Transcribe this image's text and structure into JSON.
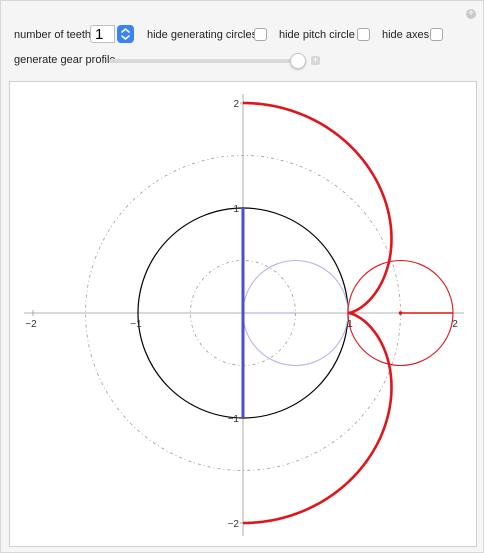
{
  "controls": {
    "num_teeth_label": "number of teeth",
    "num_teeth_value": "1",
    "hide_generating_label": "hide generating circles",
    "hide_pitch_label": "hide pitch circle",
    "hide_axes_label": "hide axes",
    "generate_profile_label": "generate gear profile",
    "generate_profile_fraction": 0.95
  },
  "plot": {
    "x_ticks": [
      "−2",
      "−1",
      "1",
      "2"
    ],
    "y_ticks": [
      "2",
      "1",
      "−1",
      "−2"
    ],
    "colors": {
      "gear": "#e0151b",
      "rolling_circle_out": "#e0151b",
      "rolling_circle_in": "#b9b4ea",
      "base": "#000000",
      "blue_segment": "#4b4fd8",
      "dashed": "#9a9a9a"
    }
  }
}
